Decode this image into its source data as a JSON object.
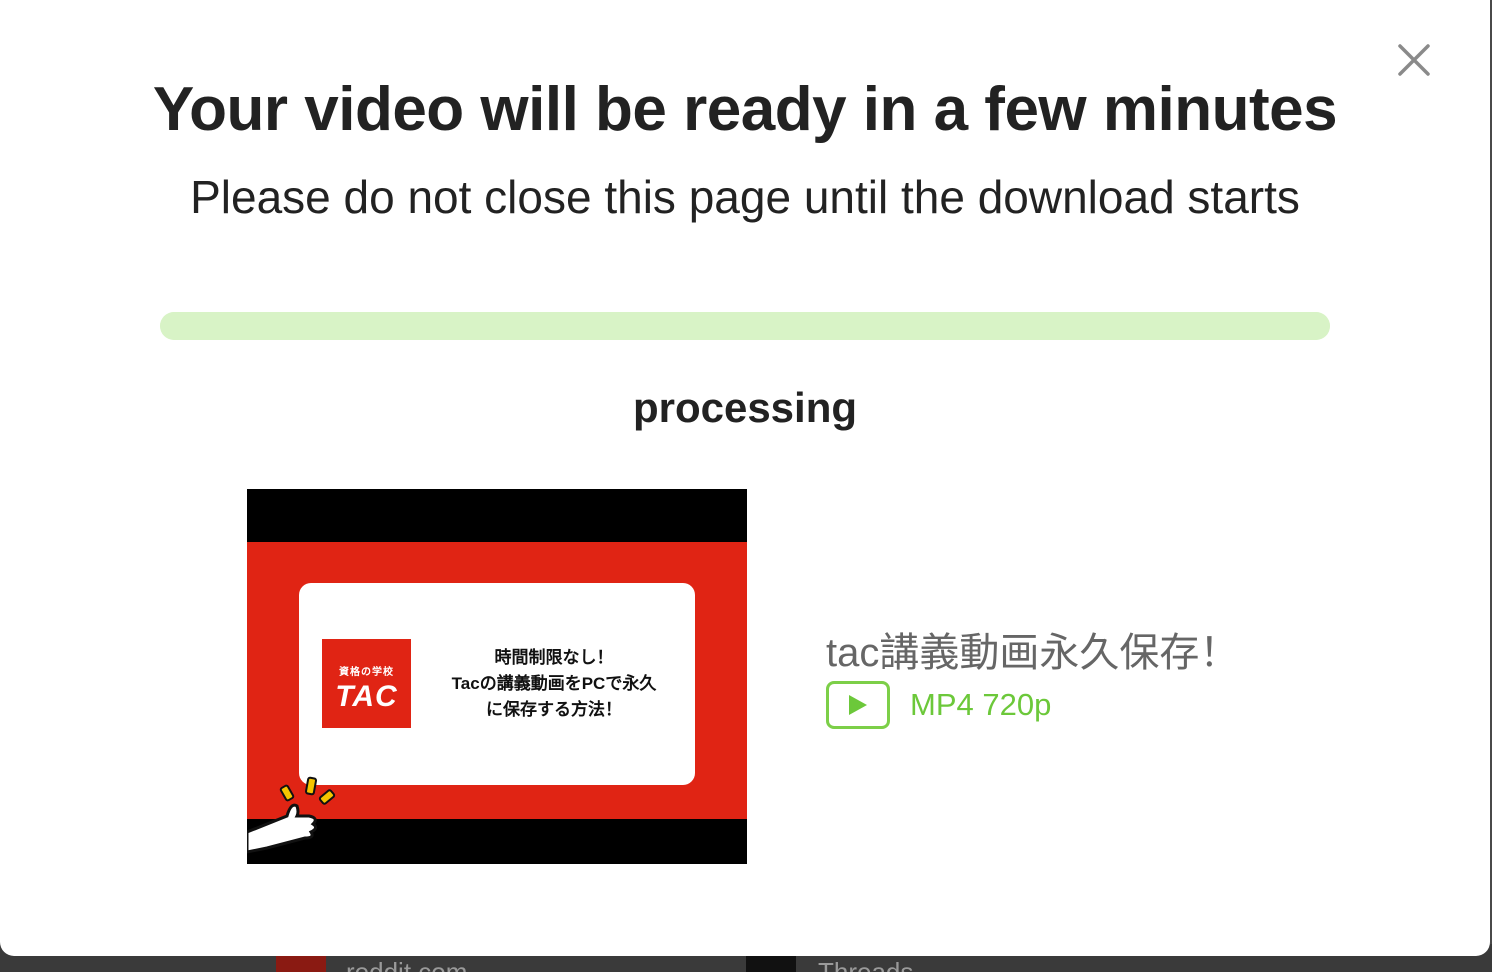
{
  "modal": {
    "title": "Your video will be ready in a few minutes",
    "subtitle": "Please do not close this page until the download starts",
    "progress_percent": 100,
    "status": "processing",
    "close_icon": "close-icon"
  },
  "video": {
    "title": "tac講義動画永久保存！",
    "thumbnail": {
      "logo_small": "資格の学校",
      "logo_big": "TAC",
      "lines": [
        "時間制限なし！",
        "Tacの講義動画をPCで永久",
        "に保存する方法！"
      ]
    },
    "format": {
      "icon": "play-icon",
      "label": "MP4 720p"
    }
  },
  "background": {
    "items": [
      "reddit.com",
      "Threads"
    ]
  },
  "colors": {
    "accent": "#6cc83a",
    "progress": "#d8f3c6",
    "thumb_red": "#e02414"
  }
}
